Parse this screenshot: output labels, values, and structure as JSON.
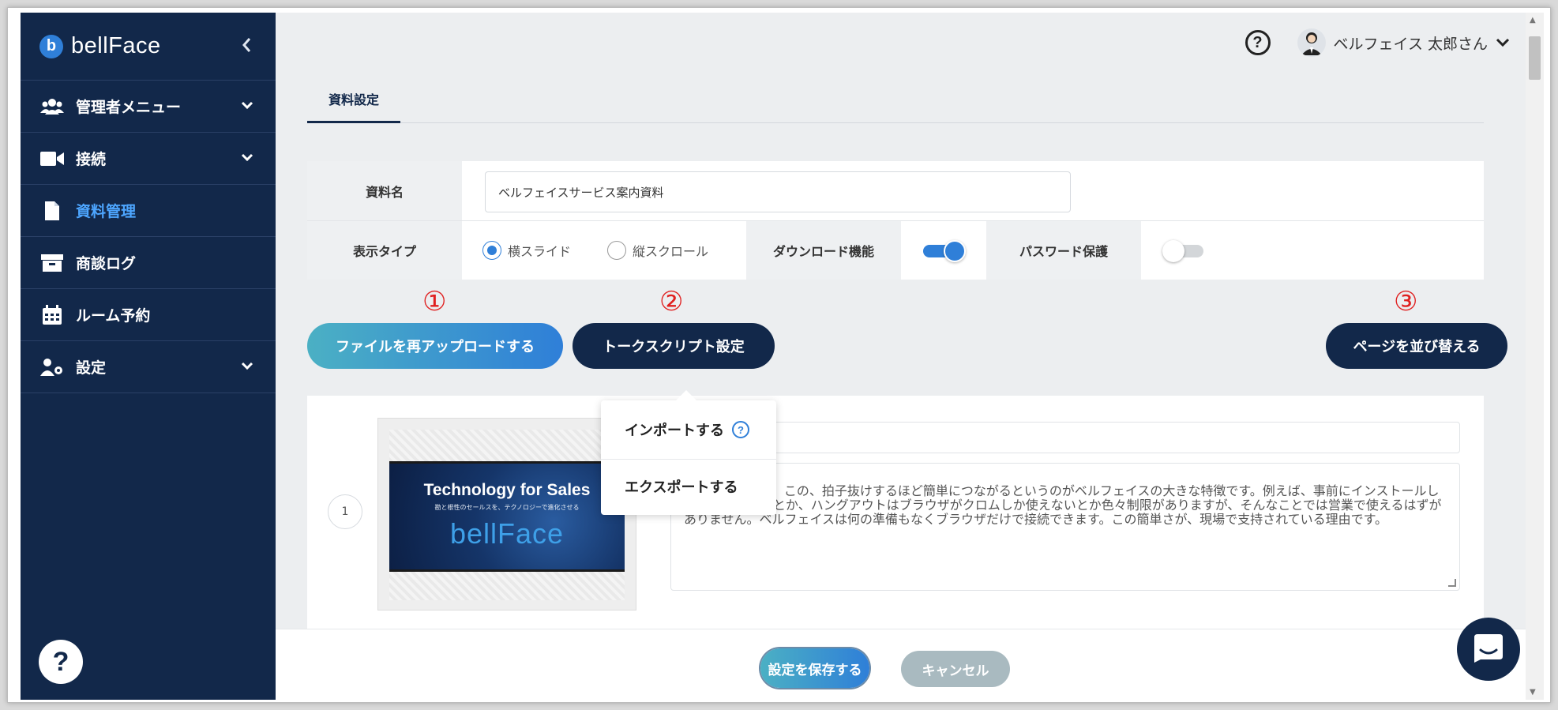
{
  "app": {
    "logo_text": "bellFace",
    "logo_letter": "b"
  },
  "sidebar": {
    "items": [
      {
        "label": "管理者メニュー",
        "icon": "users-icon"
      },
      {
        "label": "接続",
        "icon": "video-icon"
      },
      {
        "label": "資料管理",
        "icon": "document-icon",
        "active": true
      },
      {
        "label": "商談ログ",
        "icon": "archive-icon"
      },
      {
        "label": "ルーム予約",
        "icon": "calendar-icon"
      },
      {
        "label": "設定",
        "icon": "user-gear-icon"
      }
    ],
    "help_label": "?"
  },
  "header": {
    "help_label": "?",
    "user_name": "ベルフェイス 太郎さん"
  },
  "tabs": [
    {
      "label": "資料設定",
      "active": true
    }
  ],
  "form": {
    "name_label": "資料名",
    "name_value": "ベルフェイスサービス案内資料",
    "display_type_label": "表示タイプ",
    "radio_horizontal": "横スライド",
    "radio_vertical": "縦スクロール",
    "download_label": "ダウンロード機能",
    "download_on": true,
    "password_label": "パスワード保護",
    "password_on": false
  },
  "markers": {
    "one": "①",
    "two": "②",
    "three": "③"
  },
  "buttons": {
    "reupload": "ファイルを再アップロードする",
    "talk_script": "トークスクリプト設定",
    "sort_pages": "ページを並び替える",
    "save": "設定を保存する",
    "cancel": "キャンセル"
  },
  "dropdown": {
    "import": "インポートする",
    "import_help": "?",
    "export": "エクスポートする"
  },
  "page": {
    "number": "1",
    "slide_title": "Technology for Sales",
    "slide_subtitle": "勘と根性のセールスを、テクノロジーで進化させる",
    "slide_logo": "bellFace",
    "script_text": "できるんですね！この、拍子抜けするほど簡単につながるというのがベルフェイスの大きな特徴です。例えば、事前にインストールしてIDを交換するとか、ハングアウトはブラウザがクロムしか使えないとか色々制限がありますが、そんなことでは営業で使えるはずがありません。ベルフェイスは何の準備もなくブラウザだけで接続できます。この簡単さが、現場で支持されている理由です。"
  },
  "colors": {
    "sidebar": "#12284a",
    "accent": "#2f7fd8",
    "active_nav": "#4da6ff",
    "marker": "#e02020"
  }
}
